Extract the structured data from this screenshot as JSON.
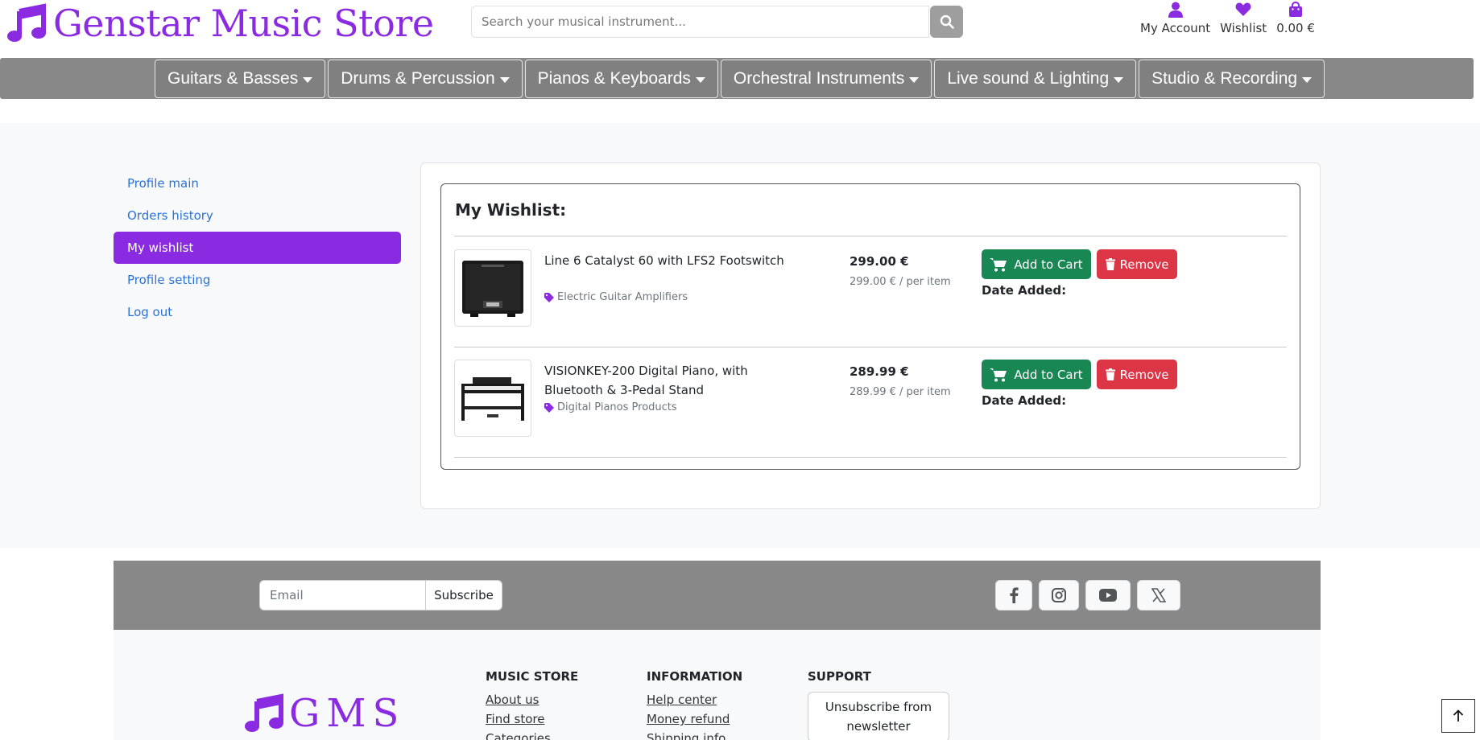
{
  "header": {
    "logo_text": "Genstar Music Store",
    "search_placeholder": "Search your musical instrument...",
    "account_label": "My Account",
    "wishlist_label": "Wishlist",
    "cart_total": "0.00 €"
  },
  "nav": {
    "items": [
      {
        "label": "Guitars & Basses"
      },
      {
        "label": "Drums & Percussion"
      },
      {
        "label": "Pianos & Keyboards"
      },
      {
        "label": "Orchestral Instruments"
      },
      {
        "label": "Live sound & Lighting"
      },
      {
        "label": "Studio & Recording"
      }
    ]
  },
  "sidebar": {
    "items": [
      {
        "label": "Profile main",
        "active": false
      },
      {
        "label": "Orders history",
        "active": false
      },
      {
        "label": "My wishlist",
        "active": true
      },
      {
        "label": "Profile setting",
        "active": false
      },
      {
        "label": "Log out",
        "active": false
      }
    ]
  },
  "wishlist": {
    "title": "My Wishlist:",
    "items": [
      {
        "name": "Line 6 Catalyst 60 with LFS2 Footswitch",
        "category": "Electric Guitar Amplifiers",
        "price": "299.00 €",
        "unit_price": "299.00 € / per item",
        "add_label": "Add to Cart",
        "remove_label": "Remove",
        "date_label": "Date Added:"
      },
      {
        "name": "VISIONKEY-200 Digital Piano, with Bluetooth & 3-Pedal Stand",
        "category": "Digital Pianos Products",
        "price": "289.99 €",
        "unit_price": "289.99 € / per item",
        "add_label": "Add to Cart",
        "remove_label": "Remove",
        "date_label": "Date Added:"
      }
    ]
  },
  "footer": {
    "email_placeholder": "Email",
    "subscribe_label": "Subscribe",
    "logo_text": "GMS",
    "columns": [
      {
        "title": "MUSIC STORE",
        "links": [
          "About us",
          "Find store",
          "Categories"
        ]
      },
      {
        "title": "INFORMATION",
        "links": [
          "Help center",
          "Money refund",
          "Shipping info"
        ]
      },
      {
        "title": "SUPPORT",
        "button": "Unsubscribe from newsletter"
      }
    ],
    "socials": [
      "facebook-icon",
      "instagram-icon",
      "youtube-icon",
      "x-icon"
    ]
  },
  "colors": {
    "brand": "#8a2be2",
    "nav_bg": "#888888",
    "success": "#198754",
    "danger": "#dc3545",
    "link": "#2b72d6"
  }
}
